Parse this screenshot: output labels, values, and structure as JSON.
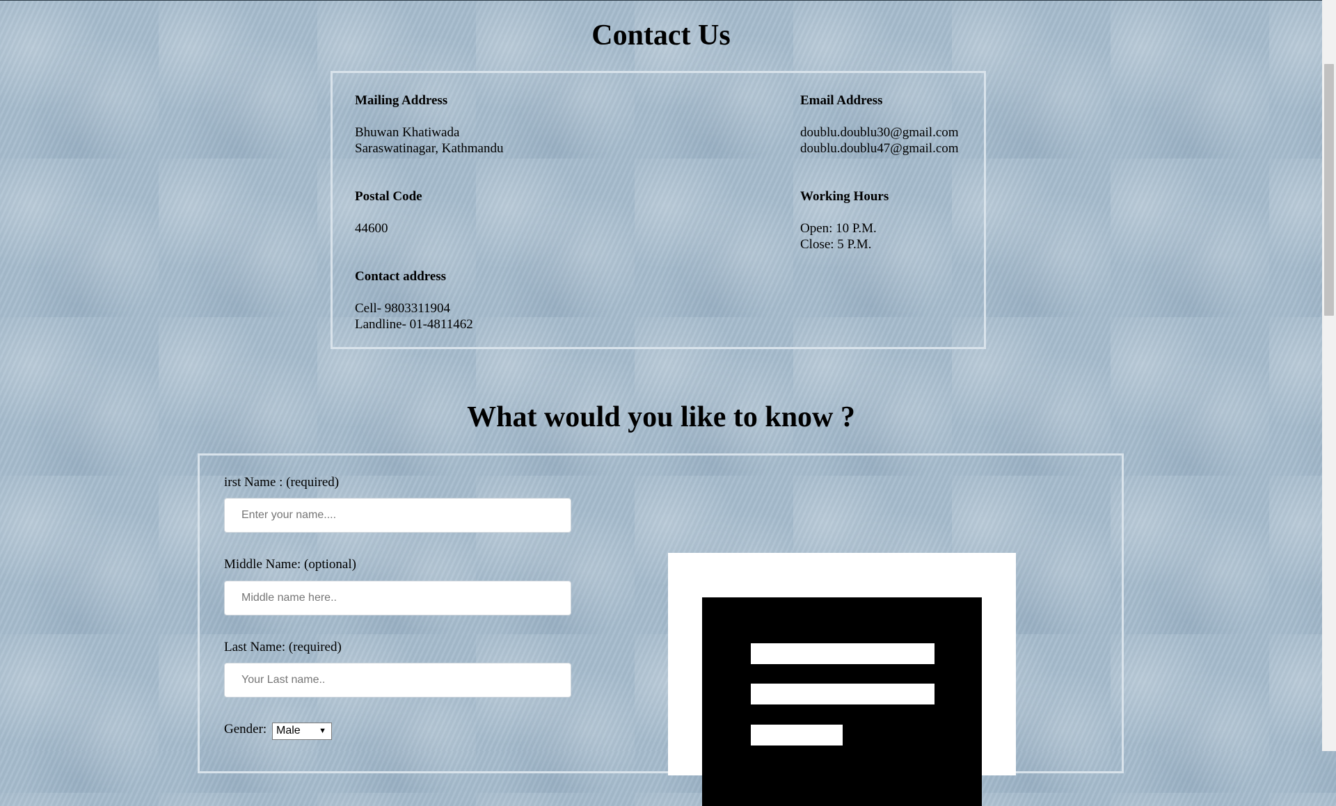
{
  "header": {
    "title": "Contact Us"
  },
  "info": {
    "mailing": {
      "heading": "Mailing Address",
      "line1": "Bhuwan Khatiwada",
      "line2": "Saraswatinagar, Kathmandu"
    },
    "email": {
      "heading": "Email Address",
      "line1": "doublu.doublu30@gmail.com",
      "line2": "doublu.doublu47@gmail.com"
    },
    "postal": {
      "heading": "Postal Code",
      "line1": "44600"
    },
    "hours": {
      "heading": "Working Hours",
      "line1": "Open: 10 P.M.",
      "line2": "Close: 5 P.M."
    },
    "contact": {
      "heading": "Contact address",
      "line1": "Cell- 9803311904",
      "line2": "Landline- 01-4811462"
    }
  },
  "form": {
    "title": "What would you like to know ?",
    "first_name": {
      "label": "irst Name : (required)",
      "placeholder": "Enter your name...."
    },
    "middle_name": {
      "label": "Middle Name: (optional)",
      "placeholder": "Middle name here.."
    },
    "last_name": {
      "label": "Last Name: (required)",
      "placeholder": "Your Last name.."
    },
    "gender": {
      "label": "Gender:",
      "selected": "Male"
    }
  },
  "icons": {
    "form_illustration": "contact-form-icon",
    "select_arrow": "dropdown-arrow-icon"
  },
  "colors": {
    "background": "#a6bccd",
    "box_border": "#d9e3eb"
  }
}
